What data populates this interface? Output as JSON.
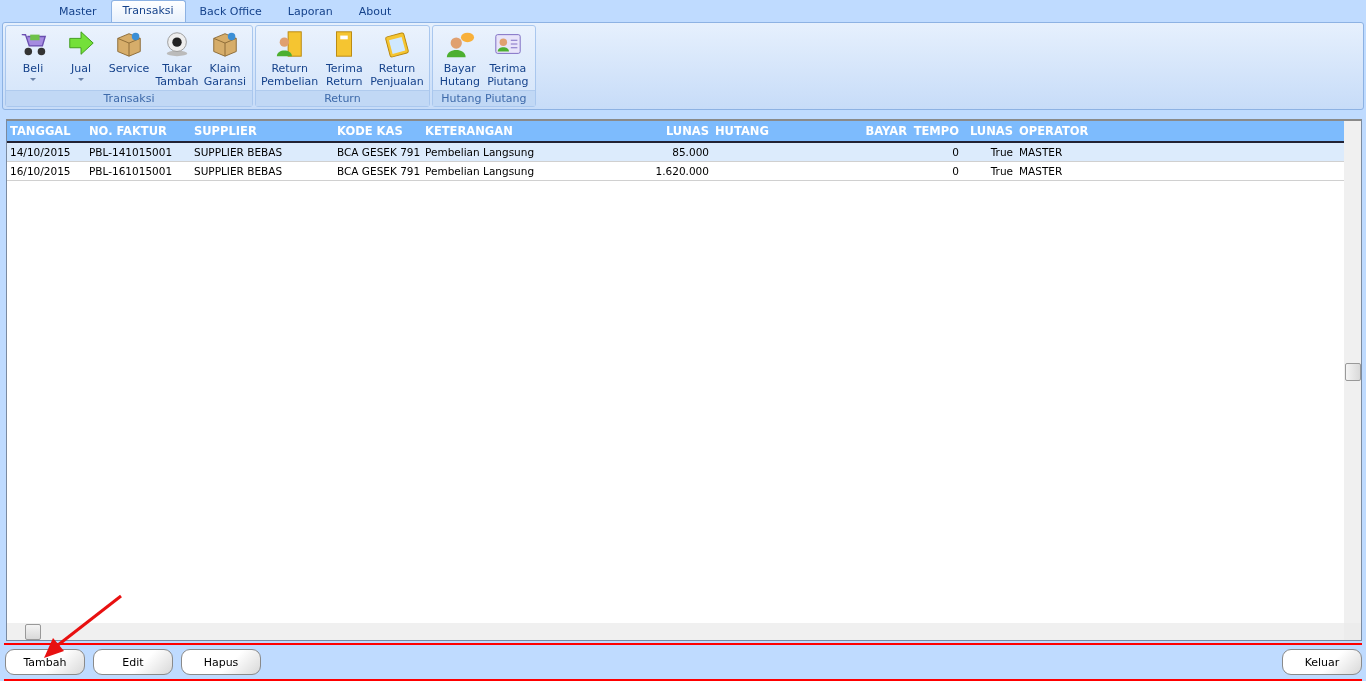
{
  "tabs": [
    {
      "label": "Master",
      "selected": false
    },
    {
      "label": "Transaksi",
      "selected": true
    },
    {
      "label": "Back Office",
      "selected": false
    },
    {
      "label": "Laporan",
      "selected": false
    },
    {
      "label": "About",
      "selected": false
    }
  ],
  "ribbon_groups": [
    {
      "title": "Transaksi",
      "buttons": [
        {
          "label": "Beli",
          "dropdown": true
        },
        {
          "label": "Jual",
          "dropdown": true
        },
        {
          "label": "Service",
          "dropdown": false
        },
        {
          "label": "Tukar\nTambah",
          "dropdown": false
        },
        {
          "label": "Klaim\nGaransi",
          "dropdown": false
        }
      ]
    },
    {
      "title": "Return",
      "buttons": [
        {
          "label": "Return\nPembelian",
          "dropdown": false
        },
        {
          "label": "Terima\nReturn",
          "dropdown": false
        },
        {
          "label": "Return\nPenjualan",
          "dropdown": false
        }
      ]
    },
    {
      "title": "Hutang Piutang",
      "buttons": [
        {
          "label": "Bayar\nHutang",
          "dropdown": false
        },
        {
          "label": "Terima\nPiutang",
          "dropdown": false
        }
      ]
    }
  ],
  "table": {
    "columns": [
      "TANGGAL",
      "NO. FAKTUR",
      "SUPPLIER",
      "KODE KAS",
      "KETERANGAN",
      "LUNAS",
      "HUTANG",
      "BAYAR",
      "TEMPO",
      "LUNAS",
      "OPERATOR"
    ],
    "rows": [
      {
        "selected": true,
        "cells": [
          "14/10/2015",
          "PBL-141015001",
          "SUPPLIER BEBAS",
          "BCA GESEK 791",
          "Pembelian Langsung",
          "85.000",
          "",
          "",
          "0",
          "True",
          "MASTER"
        ]
      },
      {
        "selected": false,
        "cells": [
          "16/10/2015",
          "PBL-161015001",
          "SUPPLIER BEBAS",
          "BCA GESEK 791",
          "Pembelian Langsung",
          "1.620.000",
          "",
          "",
          "0",
          "True",
          "MASTER"
        ]
      }
    ]
  },
  "buttons_left": [
    "Tambah",
    "Edit",
    "Hapus"
  ],
  "buttons_right": [
    "Keluar"
  ]
}
